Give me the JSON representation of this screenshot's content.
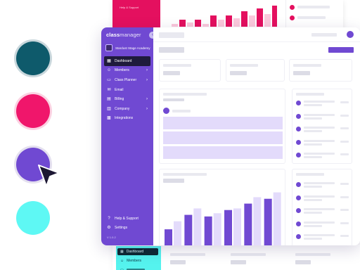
{
  "colors": {
    "teal": "#0e5a6b",
    "pink": "#f0166b",
    "purple": "#7049d2",
    "aqua": "#5ef8f4",
    "dark_navy": "#1f1b3c"
  },
  "back_top": {
    "help_support": "Help & Support"
  },
  "sidebar": {
    "logo_bold": "class",
    "logo_light": "manager",
    "academy_name": "Stardust Stage Academy",
    "items": [
      {
        "label": "Dashboard",
        "icon": "dashboard-icon",
        "active": true,
        "chevron": false
      },
      {
        "label": "Members",
        "icon": "members-icon",
        "active": false,
        "chevron": true
      },
      {
        "label": "Class Planner",
        "icon": "calendar-icon",
        "active": false,
        "chevron": true
      },
      {
        "label": "Email",
        "icon": "mail-icon",
        "active": false,
        "chevron": false
      },
      {
        "label": "Billing",
        "icon": "billing-icon",
        "active": false,
        "chevron": true
      },
      {
        "label": "Company",
        "icon": "company-icon",
        "active": false,
        "chevron": true
      },
      {
        "label": "Integrations",
        "icon": "integrations-icon",
        "active": false,
        "chevron": false
      }
    ],
    "help_label": "Help & Support",
    "settings_label": "Settings",
    "version": "V 1.0.2"
  },
  "back_bottom": {
    "dashboard_label": "Dashboard",
    "members_label": "Members"
  },
  "main_chart": {
    "series_dark": [
      20,
      38,
      36,
      44,
      52,
      58
    ],
    "series_light": [
      30,
      46,
      40,
      46,
      60,
      66
    ],
    "max": 70
  },
  "top_chart": {
    "heights": [
      4,
      10,
      6,
      10,
      4,
      16,
      10,
      16,
      12,
      22,
      16,
      26,
      18,
      30
    ]
  }
}
